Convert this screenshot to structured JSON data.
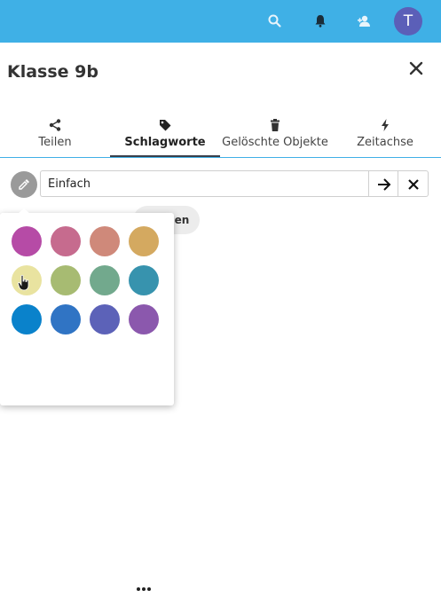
{
  "header": {
    "avatar_initial": "T",
    "icons": [
      "search-icon",
      "bell-icon",
      "user-add-icon"
    ],
    "background": "#3fb0e6"
  },
  "dialog": {
    "title": "Klasse 9b"
  },
  "tabs": [
    {
      "label": "Teilen",
      "icon": "share-icon"
    },
    {
      "label": "Schlagworte",
      "icon": "tag-icon",
      "active": true
    },
    {
      "label": "Gelöschte Objekte",
      "icon": "trash-icon"
    },
    {
      "label": "Zeitachse",
      "icon": "lightning-icon"
    }
  ],
  "tag_editor": {
    "input_value": "Einfach",
    "existing_tag_visible_text": "gen"
  },
  "color_picker": {
    "swatches": [
      "#b64ba6",
      "#c66b8e",
      "#cf897a",
      "#d4a960",
      "#e9e3a0",
      "#a7bb72",
      "#72a98d",
      "#3793ae",
      "#0a82cb",
      "#3074c4",
      "#5c62b8",
      "#8b58ad"
    ],
    "selected_index": 4,
    "more_label": "•••"
  }
}
